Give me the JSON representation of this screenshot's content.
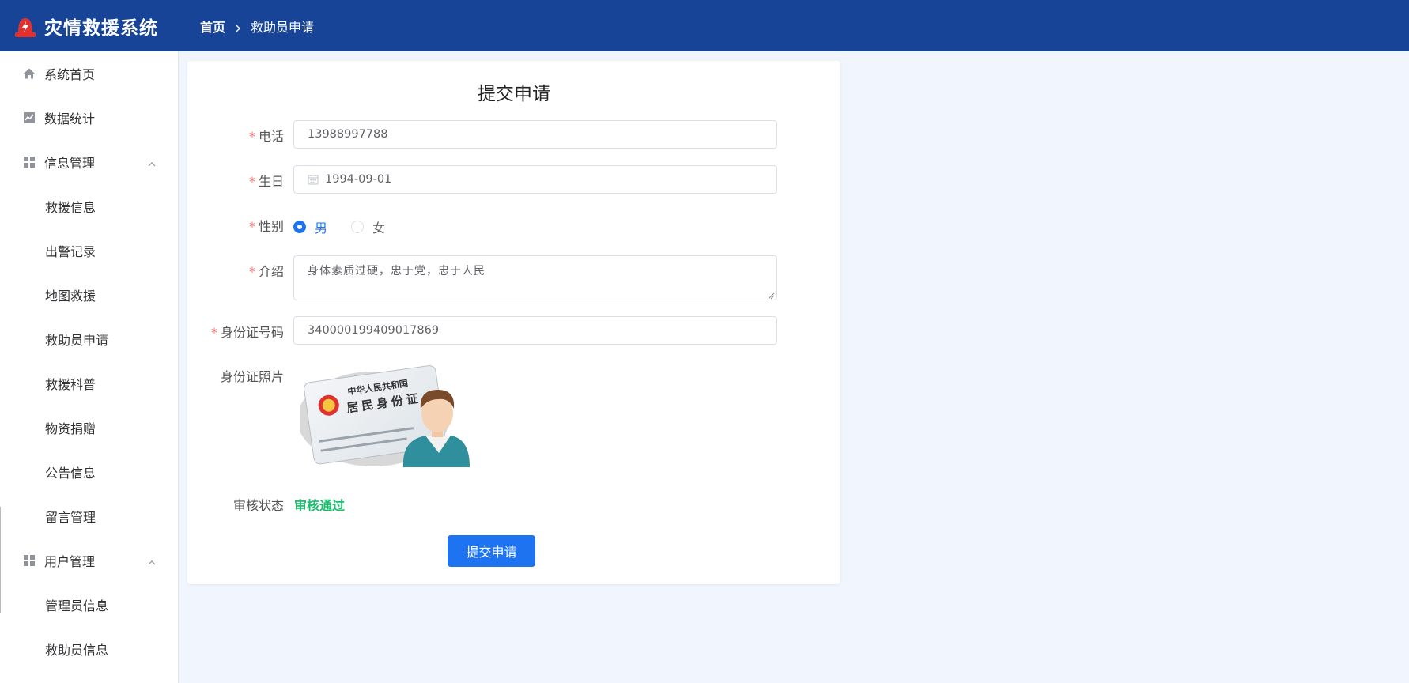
{
  "app": {
    "title": "灾情救援系统"
  },
  "breadcrumb": {
    "home": "首页",
    "current": "救助员申请"
  },
  "sidebar": {
    "items": [
      {
        "label": "系统首页",
        "icon": "home-icon"
      },
      {
        "label": "数据统计",
        "icon": "chart-icon"
      },
      {
        "label": "信息管理",
        "icon": "grid-icon",
        "expanded": true
      },
      {
        "label": "救援信息"
      },
      {
        "label": "出警记录"
      },
      {
        "label": "地图救援"
      },
      {
        "label": "救助员申请"
      },
      {
        "label": "救援科普"
      },
      {
        "label": "物资捐赠"
      },
      {
        "label": "公告信息"
      },
      {
        "label": "留言管理"
      },
      {
        "label": "用户管理",
        "icon": "grid-icon",
        "expanded": true
      },
      {
        "label": "管理员信息"
      },
      {
        "label": "救助员信息"
      }
    ]
  },
  "form": {
    "title": "提交申请",
    "phone": {
      "label": "电话",
      "value": "13988997788"
    },
    "birthday": {
      "label": "生日",
      "value": "1994-09-01"
    },
    "gender": {
      "label": "性别",
      "options": [
        "男",
        "女"
      ],
      "selected": "男"
    },
    "intro": {
      "label": "介绍",
      "value": "身体素质过硬，忠于党，忠于人民"
    },
    "id_number": {
      "label": "身份证号码",
      "value": "340000199409017869"
    },
    "id_photo": {
      "label": "身份证照片",
      "card_text_1": "中华人民共和国",
      "card_text_2": "居民身份证"
    },
    "review": {
      "label": "审核状态",
      "value": "审核通过"
    },
    "submit_label": "提交申请"
  },
  "colors": {
    "header_bg": "#174497",
    "primary": "#1d73f0",
    "success": "#19be6b",
    "required": "#f56c6c",
    "page_bg": "#f1f5fe"
  }
}
